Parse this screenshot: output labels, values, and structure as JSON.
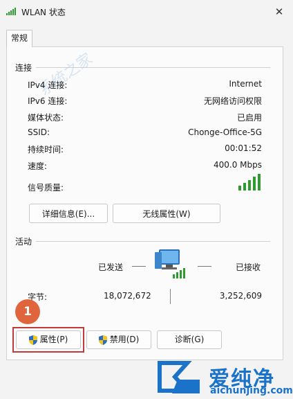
{
  "window": {
    "title": "WLAN 状态"
  },
  "tabs": [
    {
      "label": "常规"
    }
  ],
  "connection": {
    "group_label": "连接",
    "rows": [
      {
        "label": "IPv4 连接:",
        "value": "Internet"
      },
      {
        "label": "IPv6 连接:",
        "value": "无网络访问权限"
      },
      {
        "label": "媒体状态:",
        "value": "已启用"
      },
      {
        "label": "SSID:",
        "value": "Chonge-Office-5G"
      },
      {
        "label": "持续时间:",
        "value": "00:01:52"
      },
      {
        "label": "速度:",
        "value": "400.0 Mbps"
      }
    ],
    "signal_label": "信号质量:",
    "signal_bars": 5,
    "signal_max": 5,
    "details_button": "详细信息(E)...",
    "wireless_button": "无线属性(W)"
  },
  "activity": {
    "group_label": "活动",
    "sent_label": "已发送",
    "received_label": "已接收",
    "bytes_label": "字节:",
    "sent_bytes": "18,072,672",
    "received_bytes": "3,252,609"
  },
  "buttons": {
    "properties": "属性(P)",
    "disable": "禁用(D)",
    "diagnose": "诊断(G)"
  },
  "annotation": {
    "step": "1"
  },
  "watermark": {
    "brand": "爱纯净",
    "url": "aichunjing.com",
    "bg_text": "系统之家"
  },
  "colors": {
    "signal_green": "#2e9b2e",
    "highlight_red": "#c03a3a",
    "badge_orange": "#e0643c",
    "brand_blue": "#1a72c9"
  }
}
